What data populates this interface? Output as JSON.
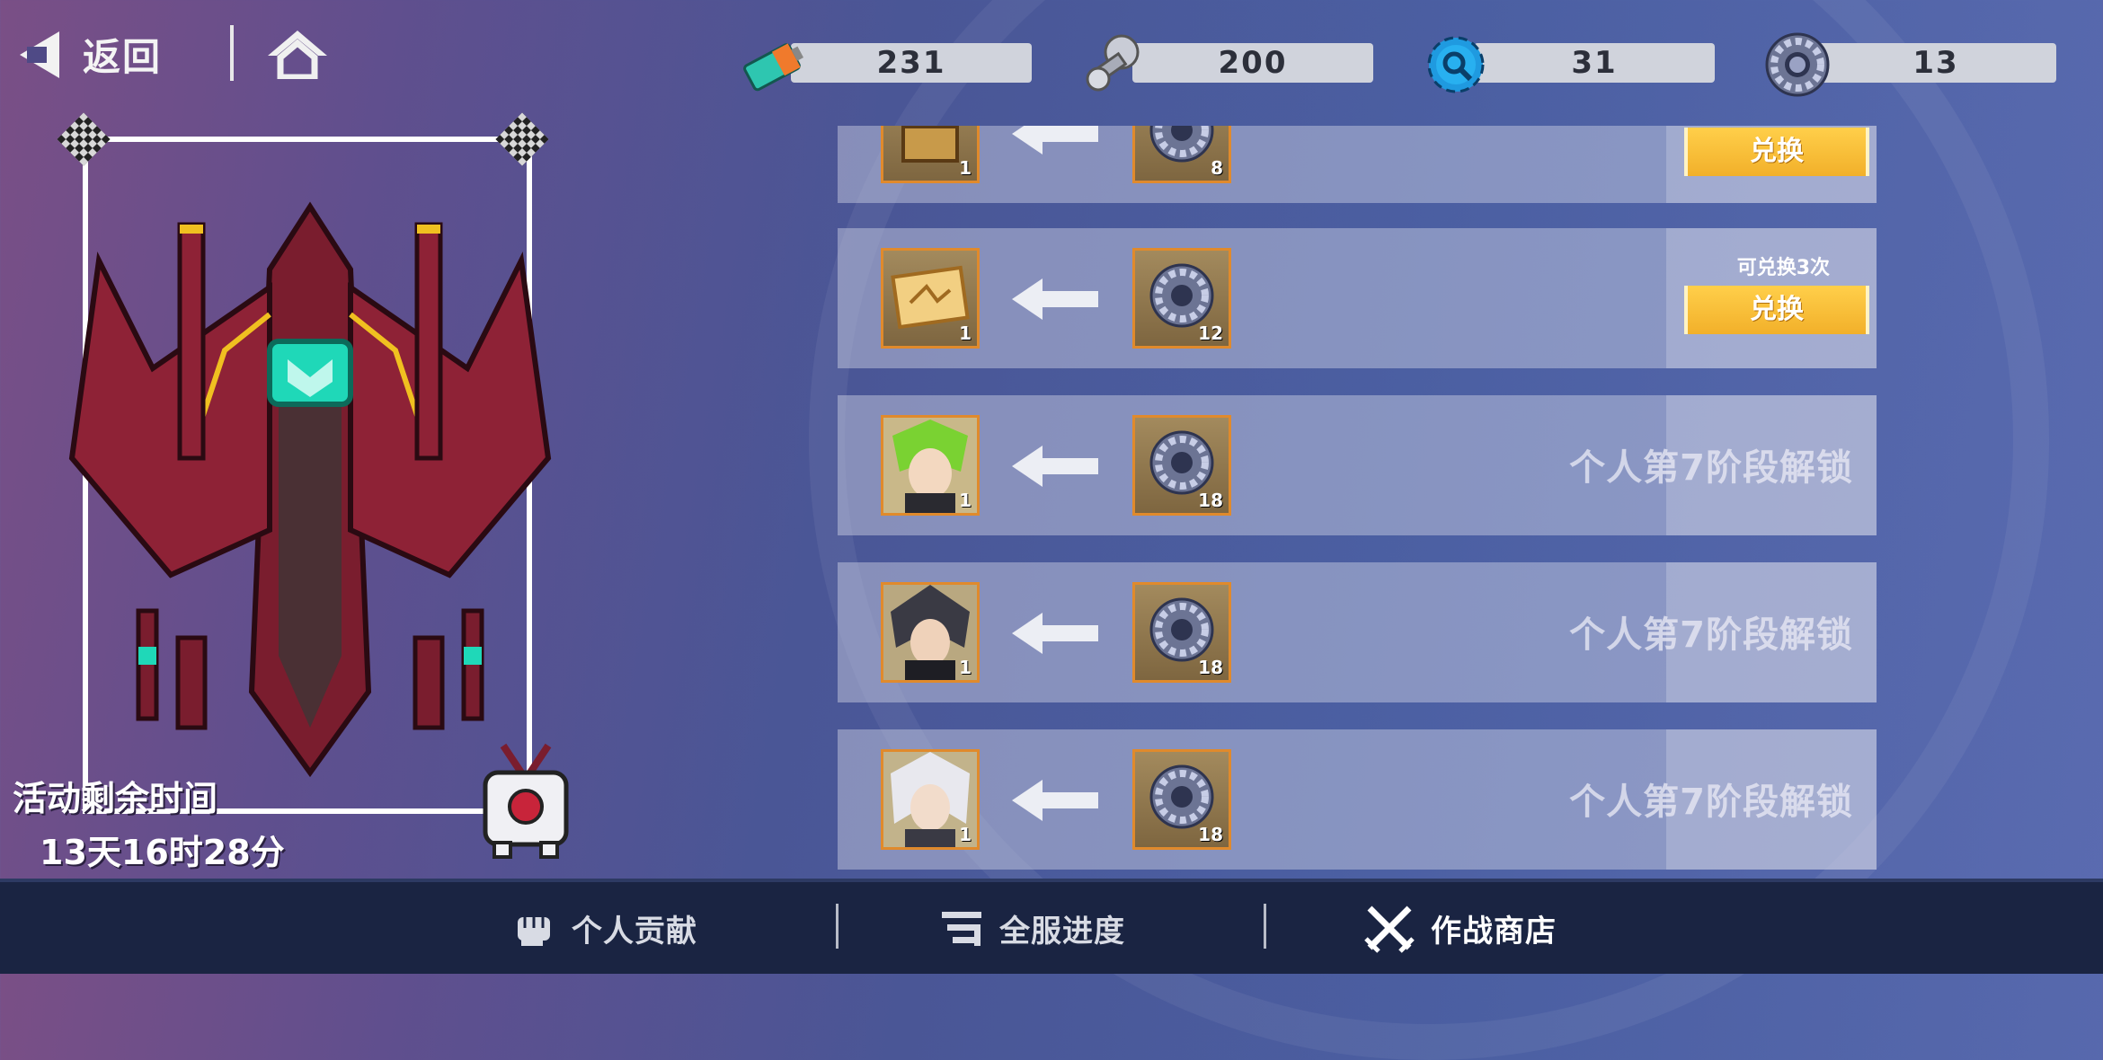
{
  "header": {
    "back_label": "返回",
    "resources": [
      {
        "icon": "battery-icon",
        "value": "231"
      },
      {
        "icon": "screw-bolt-icon",
        "value": "200"
      },
      {
        "icon": "gear-icon",
        "value": "31"
      },
      {
        "icon": "bearing-icon",
        "value": "13"
      }
    ]
  },
  "event": {
    "timer_label": "活动剩余时间",
    "timer_value": "13天16时28分"
  },
  "exchange_list": [
    {
      "reward_icon": "treasure-chest-icon",
      "reward_count": "1",
      "cost_icon": "bearing-icon",
      "cost_count": "8",
      "button": "兑换",
      "limit": ""
    },
    {
      "reward_icon": "gold-card-icon",
      "reward_count": "1",
      "cost_icon": "bearing-icon",
      "cost_count": "12",
      "button": "兑换",
      "limit": "可兑换3次"
    },
    {
      "reward_icon": "green-hair-character-portrait",
      "reward_count": "1",
      "cost_icon": "bearing-icon",
      "cost_count": "18",
      "locked_text": "个人第7阶段解锁"
    },
    {
      "reward_icon": "dark-hair-character-portrait",
      "reward_count": "1",
      "cost_icon": "bearing-icon",
      "cost_count": "18",
      "locked_text": "个人第7阶段解锁"
    },
    {
      "reward_icon": "white-hair-character-portrait",
      "reward_count": "1",
      "cost_icon": "bearing-icon",
      "cost_count": "18",
      "locked_text": "个人第7阶段解锁"
    }
  ],
  "bottom_nav": {
    "tabs": [
      {
        "label": "个人贡献",
        "icon": "fist-icon"
      },
      {
        "label": "全服进度",
        "icon": "progress-bars-icon"
      },
      {
        "label": "作战商店",
        "icon": "crossed-swords-icon",
        "active": true
      }
    ]
  },
  "colors": {
    "accent_button": "#f5b82e",
    "slot_border": "#e08a2c",
    "nav_bg": "#1a2442"
  }
}
